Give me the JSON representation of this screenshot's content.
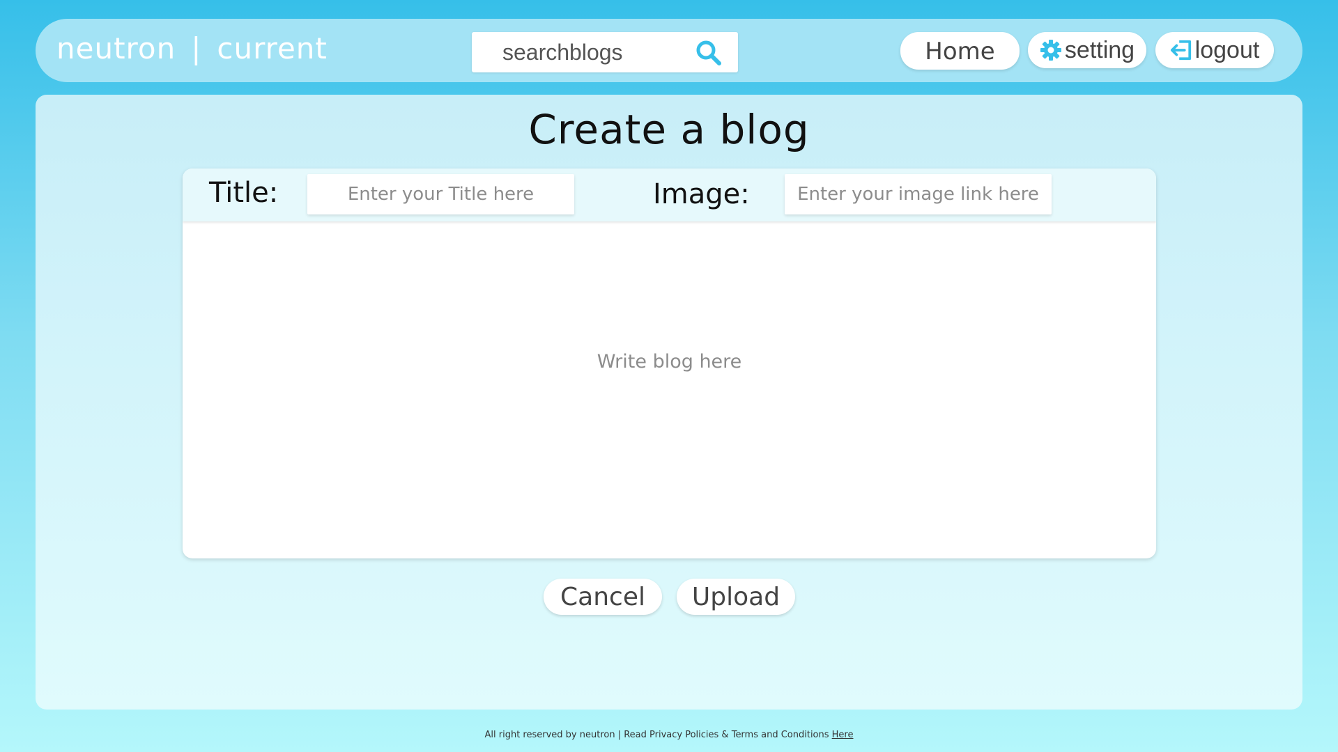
{
  "navbar": {
    "brand_name": "neutron",
    "brand_separator": "|",
    "brand_section": "current",
    "search_placeholder": "searchblogs",
    "home_label": "Home",
    "setting_label": "setting",
    "logout_label": "logout"
  },
  "main": {
    "page_title": "Create a blog",
    "title_label": "Title:",
    "title_placeholder": "Enter your Title here",
    "image_label": "Image:",
    "image_placeholder": "Enter your image link here",
    "body_placeholder": "Write blog here",
    "cancel_label": "Cancel",
    "upload_label": "Upload"
  },
  "footer": {
    "text": "All right reserved by neutron  |  Read Privacy Policies & Terms and Conditions ",
    "link_text": "Here"
  },
  "icons": {
    "search": "search-icon",
    "setting": "gear-icon",
    "logout": "logout-icon"
  },
  "colors": {
    "accent": "#36bfe9",
    "navbar_bg": "#a3e3f5",
    "text_dark": "#111111"
  }
}
